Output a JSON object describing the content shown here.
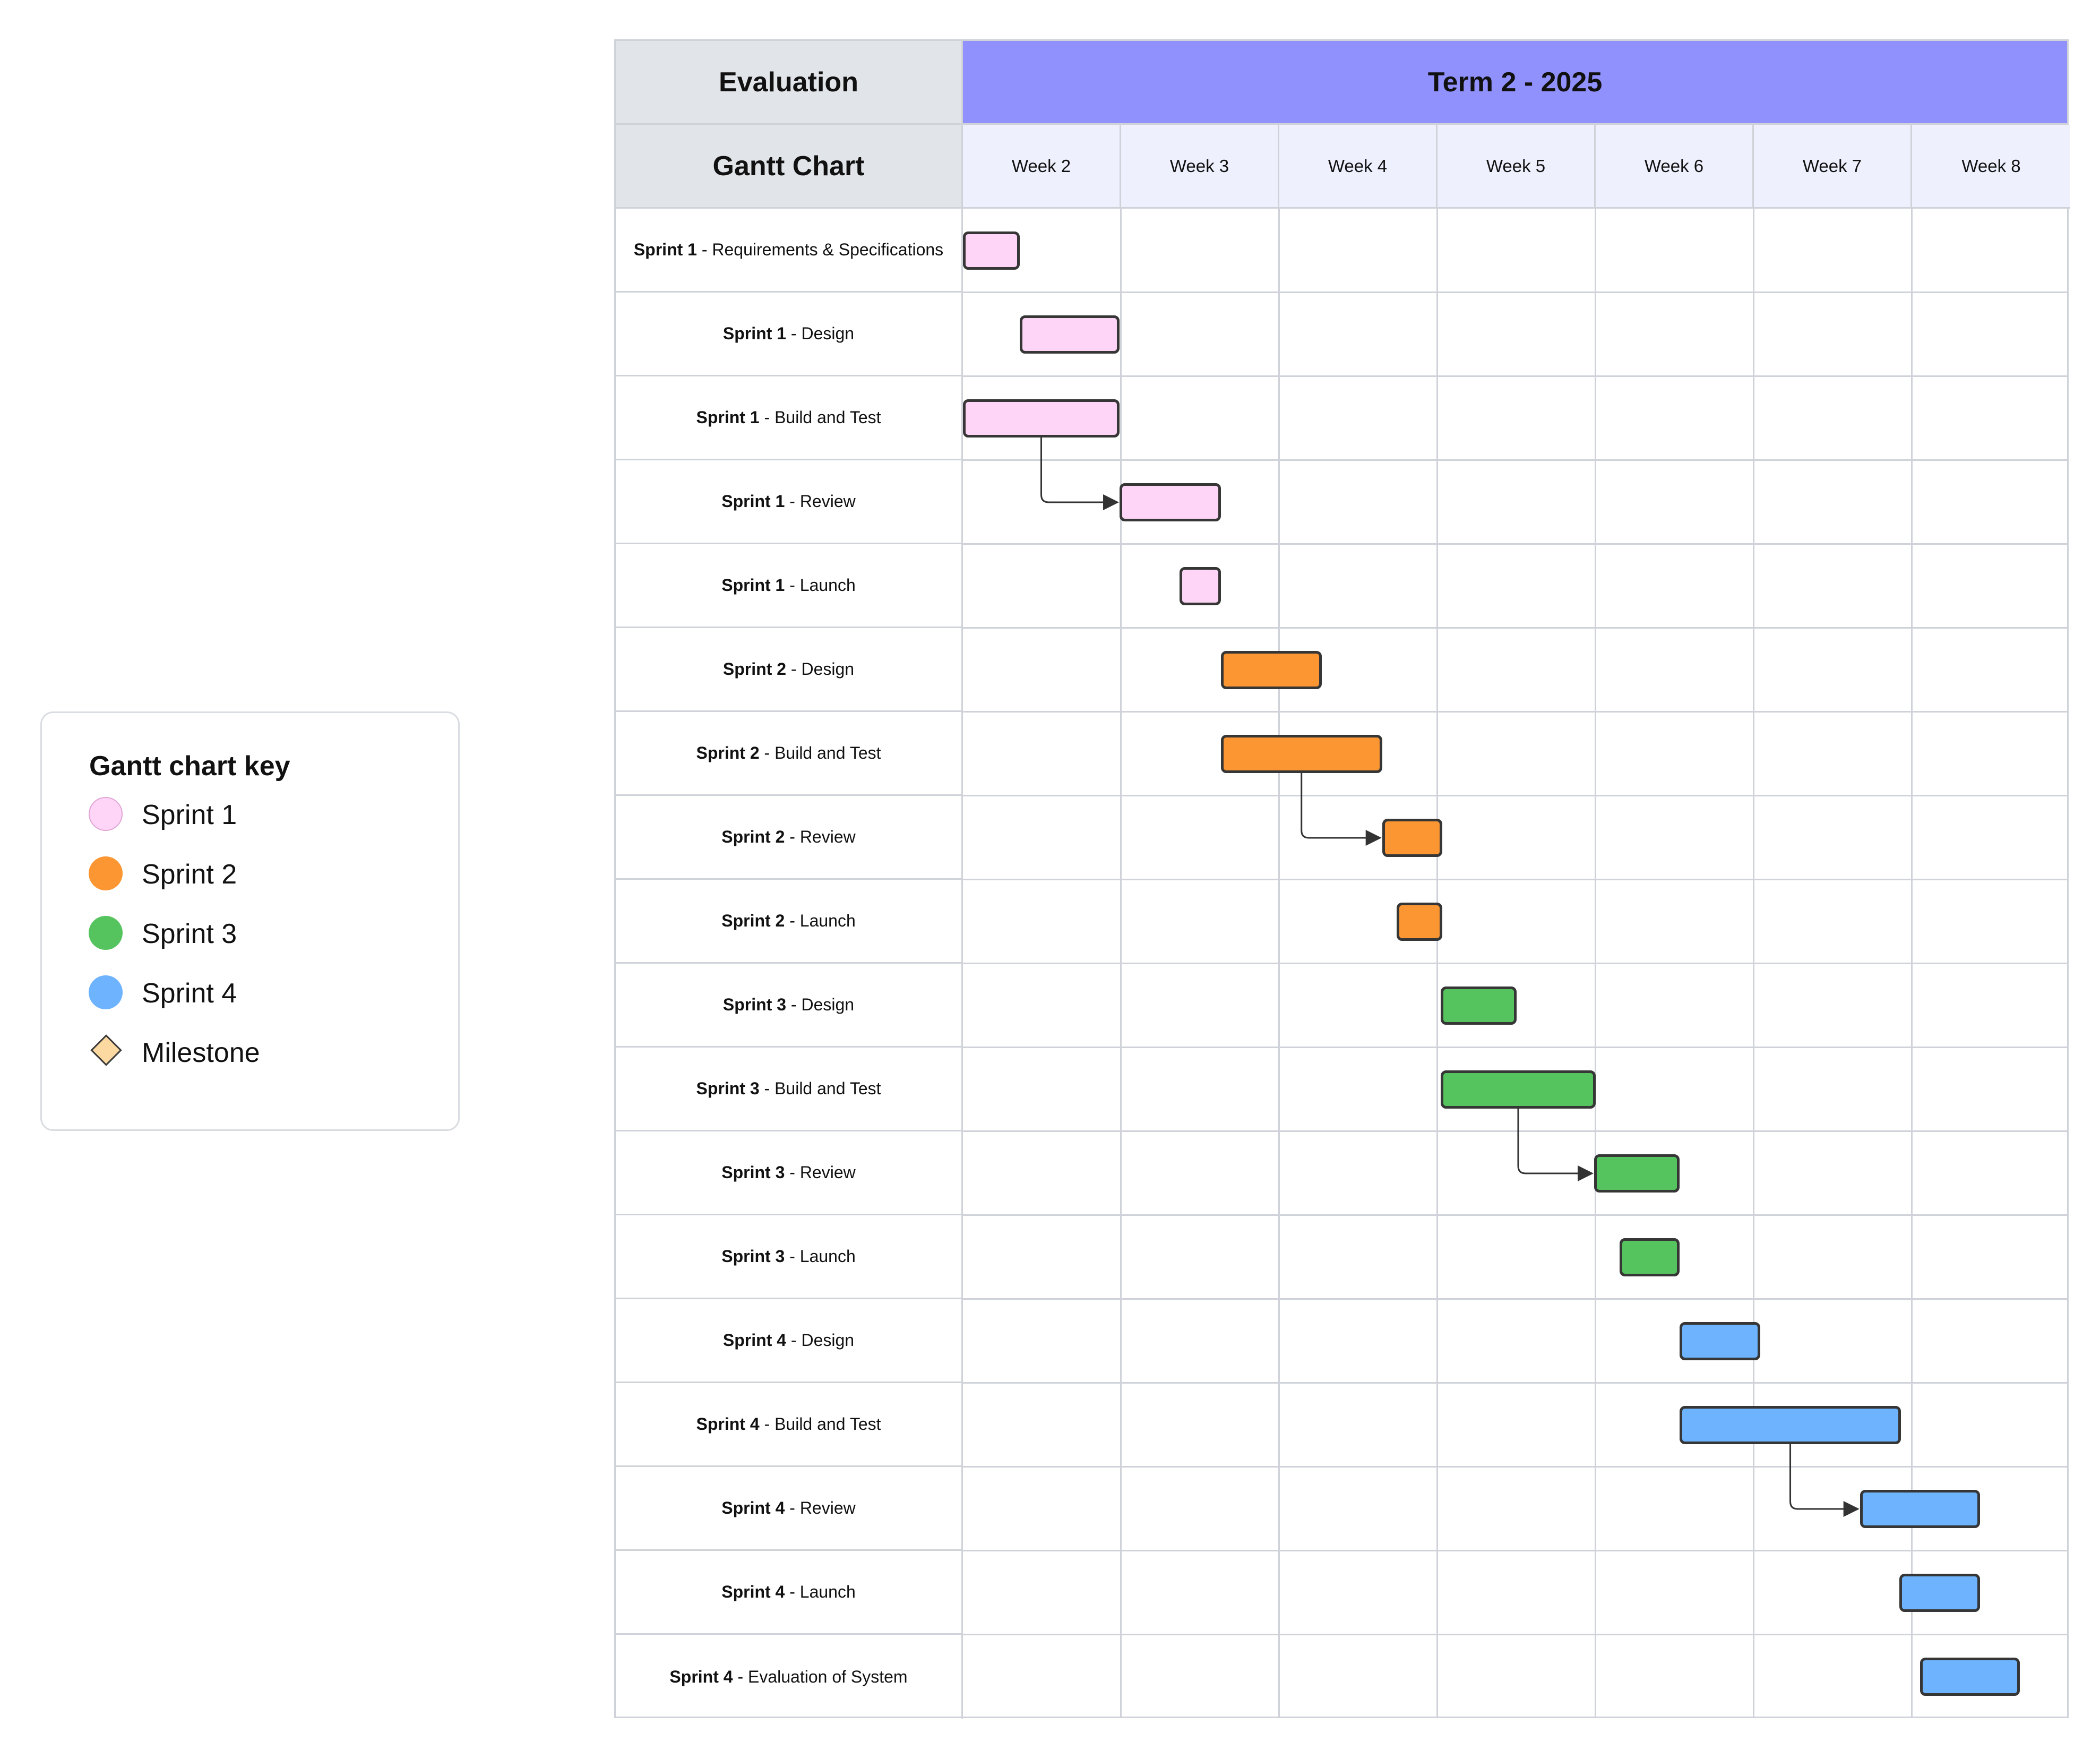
{
  "key": {
    "title": "Gantt chart key",
    "items": [
      {
        "label": "Sprint 1",
        "color": "#fed5f6",
        "shape": "circle"
      },
      {
        "label": "Sprint 2",
        "color": "#fb9633",
        "shape": "circle"
      },
      {
        "label": "Sprint 3",
        "color": "#55c45f",
        "shape": "circle"
      },
      {
        "label": "Sprint 4",
        "color": "#6eb3fd",
        "shape": "circle"
      },
      {
        "label": "Milestone",
        "color": "#fcd9a0",
        "shape": "diamond"
      }
    ]
  },
  "gantt": {
    "header_left_top": "Evaluation",
    "header_left_bottom": "Gantt Chart",
    "term": "Term 2 - 2025",
    "term_color": "#9191fe",
    "weeks": [
      "Week 2",
      "Week 3",
      "Week 4",
      "Week 5",
      "Week 6",
      "Week 7",
      "Week 8"
    ],
    "tasks": [
      {
        "sprint": "Sprint 1",
        "name": "Requirements & Specifications",
        "sprint_no": 1,
        "start": 0.0,
        "end": 0.36
      },
      {
        "sprint": "Sprint 1",
        "name": "Design",
        "sprint_no": 1,
        "start": 0.36,
        "end": 0.99
      },
      {
        "sprint": "Sprint 1",
        "name": "Build and Test",
        "sprint_no": 1,
        "start": 0.0,
        "end": 0.99
      },
      {
        "sprint": "Sprint 1",
        "name": "Review",
        "sprint_no": 1,
        "start": 0.99,
        "end": 1.63,
        "depends_on": 2
      },
      {
        "sprint": "Sprint 1",
        "name": "Launch",
        "sprint_no": 1,
        "start": 1.37,
        "end": 1.63
      },
      {
        "sprint": "Sprint 2",
        "name": "Design",
        "sprint_no": 2,
        "start": 1.63,
        "end": 2.27
      },
      {
        "sprint": "Sprint 2",
        "name": "Build and Test",
        "sprint_no": 2,
        "start": 1.63,
        "end": 2.65
      },
      {
        "sprint": "Sprint 2",
        "name": "Review",
        "sprint_no": 2,
        "start": 2.65,
        "end": 3.03,
        "depends_on": 6
      },
      {
        "sprint": "Sprint 2",
        "name": "Launch",
        "sprint_no": 2,
        "start": 2.74,
        "end": 3.03
      },
      {
        "sprint": "Sprint 3",
        "name": "Design",
        "sprint_no": 3,
        "start": 3.02,
        "end": 3.5
      },
      {
        "sprint": "Sprint 3",
        "name": "Build and Test",
        "sprint_no": 3,
        "start": 3.02,
        "end": 4.0
      },
      {
        "sprint": "Sprint 3",
        "name": "Review",
        "sprint_no": 3,
        "start": 3.99,
        "end": 4.53,
        "depends_on": 10
      },
      {
        "sprint": "Sprint 3",
        "name": "Launch",
        "sprint_no": 3,
        "start": 4.15,
        "end": 4.53
      },
      {
        "sprint": "Sprint 4",
        "name": "Design",
        "sprint_no": 4,
        "start": 4.53,
        "end": 5.04
      },
      {
        "sprint": "Sprint 4",
        "name": "Build and Test",
        "sprint_no": 4,
        "start": 4.53,
        "end": 5.93
      },
      {
        "sprint": "Sprint 4",
        "name": "Review",
        "sprint_no": 4,
        "start": 5.67,
        "end": 6.43,
        "depends_on": 14
      },
      {
        "sprint": "Sprint 4",
        "name": "Launch",
        "sprint_no": 4,
        "start": 5.92,
        "end": 6.43
      },
      {
        "sprint": "Sprint 4",
        "name": "Evaluation of System",
        "sprint_no": 4,
        "start": 6.05,
        "end": 6.68
      }
    ]
  }
}
